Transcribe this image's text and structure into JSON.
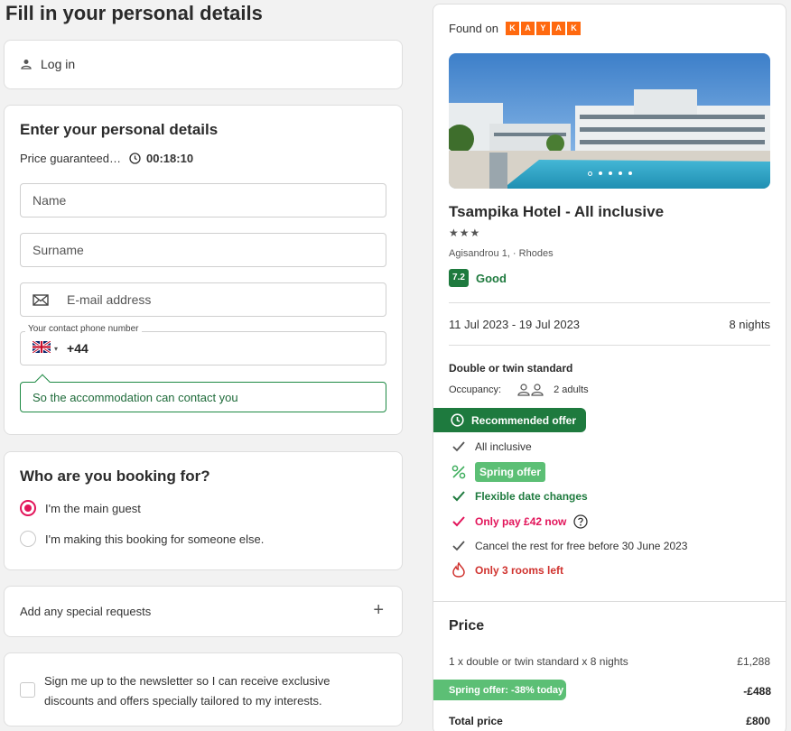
{
  "page": {
    "title": "Fill in your personal details"
  },
  "login": {
    "label": "Log in"
  },
  "details": {
    "title": "Enter your personal details",
    "price_guaranteed": "Price guaranteed…",
    "timer": "00:18:10",
    "name_placeholder": "Name",
    "surname_placeholder": "Surname",
    "email_placeholder": "E-mail address",
    "phone_label": "Your contact phone number",
    "phone_code": "+44",
    "hint": "So the accommodation can contact you"
  },
  "who": {
    "title": "Who are you booking for?",
    "options": [
      "I'm the main guest",
      "I'm making this booking for someone else."
    ],
    "selected": 0
  },
  "special": {
    "label": "Add any special requests"
  },
  "newsletter": {
    "text": "Sign me up to the newsletter so I can receive exclusive discounts and offers specially tailored to my interests."
  },
  "summary": {
    "found_on": "Found on",
    "kayak_letters": [
      "K",
      "A",
      "Y",
      "A",
      "K"
    ],
    "hotel_name": "Tsampika Hotel - All inclusive",
    "stars": 3,
    "address": "Agisandrou 1, · Rhodes",
    "rating_score": "7.2",
    "rating_text": "Good",
    "dates": "11 Jul 2023 - 19 Jul 2023",
    "nights": "8 nights",
    "room_type": "Double or twin standard",
    "occupancy_label": "Occupancy:",
    "occupancy_value": "2 adults",
    "recommended": "Recommended offer",
    "features": {
      "all_inclusive": "All inclusive",
      "spring_offer": "Spring offer",
      "flexible": "Flexible date changes",
      "pay_now": "Only pay £42 now",
      "cancel": "Cancel the rest for free before 30 June 2023",
      "rooms_left": "Only 3 rooms left"
    }
  },
  "price": {
    "title": "Price",
    "line_label": "1 x double or twin standard x 8 nights",
    "line_value": "£1,288",
    "offer_label": "Spring offer: -38% today",
    "offer_value": "-£488",
    "total_label": "Total price",
    "total_value": "£800"
  },
  "colors": {
    "accent_pink": "#e2145a",
    "brand_green": "#1e7a3e",
    "offer_green": "#5cbf75",
    "kayak_orange": "#ff690f"
  }
}
